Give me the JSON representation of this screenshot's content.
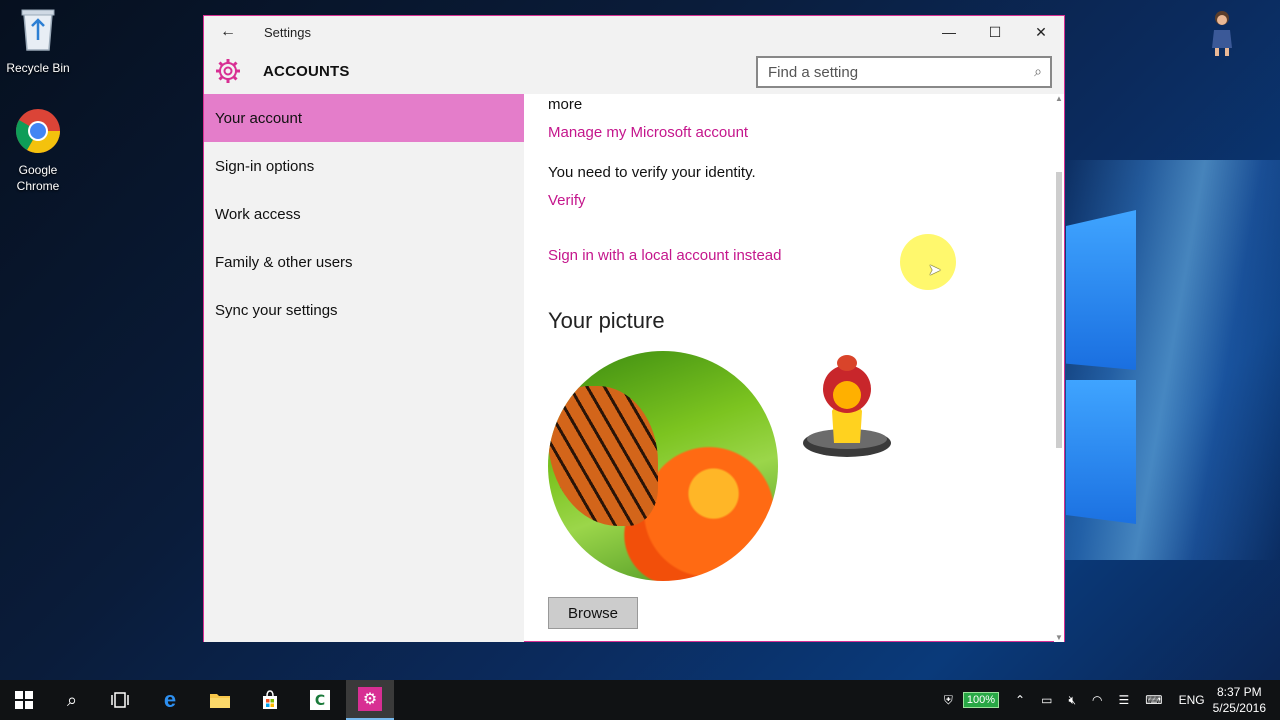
{
  "desktop": {
    "icons": [
      {
        "label": "Recycle Bin",
        "icon": "recycle-bin-icon"
      },
      {
        "label": "Google Chrome",
        "icon": "chrome-icon"
      }
    ]
  },
  "window": {
    "title": "Settings",
    "back_glyph": "←",
    "controls": {
      "minimize": "—",
      "maximize": "☐",
      "close": "✕"
    },
    "header_title": "ACCOUNTS",
    "search": {
      "placeholder": "Find a setting"
    },
    "accent_color": "#d82f93"
  },
  "sidebar": {
    "items": [
      {
        "label": "Your account",
        "active": true
      },
      {
        "label": "Sign-in options",
        "active": false
      },
      {
        "label": "Work access",
        "active": false
      },
      {
        "label": "Family & other users",
        "active": false
      },
      {
        "label": "Sync your settings",
        "active": false
      }
    ]
  },
  "content": {
    "more_text": "more",
    "manage_link": "Manage my Microsoft account",
    "verify_text": "You need to verify your identity.",
    "verify_link": "Verify",
    "local_account_link": "Sign in with a local account instead",
    "picture_heading": "Your picture",
    "browse_label": "Browse"
  },
  "taskbar": {
    "battery": "100%",
    "language": "ENG",
    "time": "8:37 PM",
    "date": "5/25/2016"
  }
}
